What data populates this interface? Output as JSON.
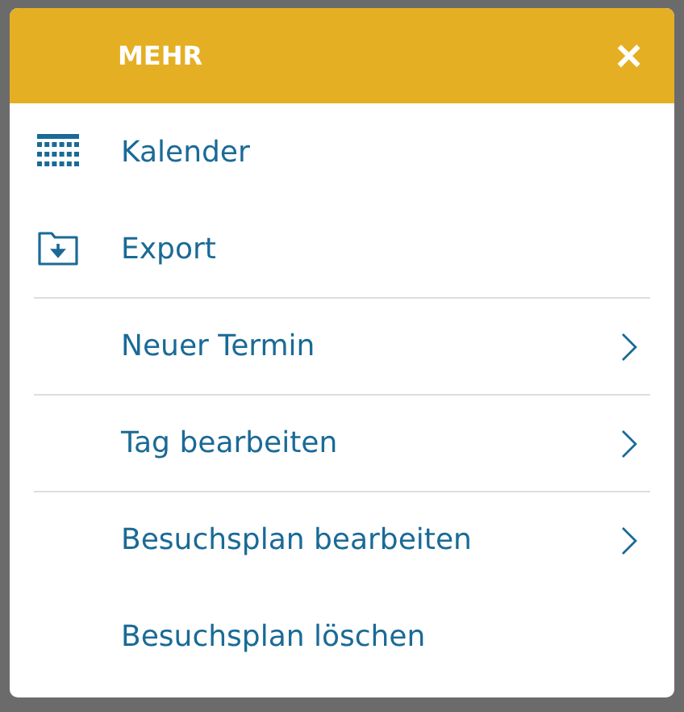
{
  "dialog": {
    "title": "MEHR",
    "close_label": "×"
  },
  "sections": [
    {
      "items": [
        {
          "label": "Kalender",
          "kind": "calendar",
          "submenu": false
        },
        {
          "label": "Export",
          "kind": "export",
          "submenu": false
        }
      ]
    },
    {
      "items": [
        {
          "label": "Neuer Termin",
          "kind": "plain",
          "submenu": true
        }
      ]
    },
    {
      "items": [
        {
          "label": "Tag bearbeiten",
          "kind": "plain",
          "submenu": true
        }
      ]
    },
    {
      "items": [
        {
          "label": "Besuchsplan bearbeiten",
          "kind": "plain",
          "submenu": true
        },
        {
          "label": "Besuchsplan löschen",
          "kind": "plain",
          "submenu": false
        }
      ]
    }
  ]
}
